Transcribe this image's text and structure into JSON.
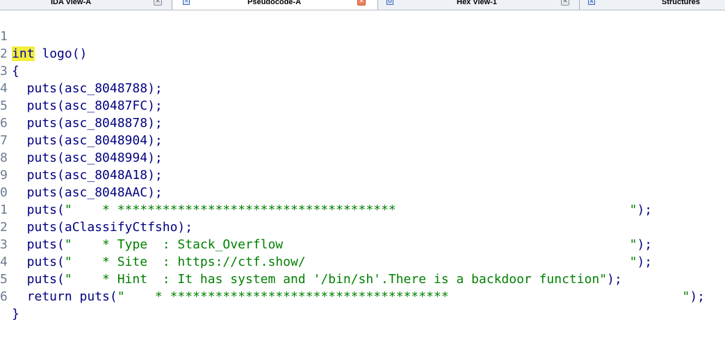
{
  "tabs": [
    {
      "label": "IDA View-A",
      "active": false,
      "icon": "ida-view-icon"
    },
    {
      "label": "Pseudocode-A",
      "active": true,
      "icon": "pseudocode-icon"
    },
    {
      "label": "Hex View-1",
      "active": false,
      "icon": "hex-view-icon"
    },
    {
      "label": "Structures",
      "active": false,
      "icon": "structures-icon"
    }
  ],
  "close_glyph": "✕",
  "code": {
    "line_numbers": [
      "1",
      "2",
      "3",
      "4",
      "5",
      "6",
      "7",
      "8",
      "9",
      "0",
      "1",
      "2",
      "3",
      "4",
      "5",
      "6"
    ],
    "lines": {
      "l1_kw": "int",
      "l1_rest": " logo()",
      "l2": "{",
      "l3": "  puts(asc_8048788);",
      "l4": "  puts(asc_80487FC);",
      "l5": "  puts(asc_8048878);",
      "l6": "  puts(asc_8048904);",
      "l7": "  puts(asc_8048994);",
      "l8": "  puts(asc_8048A18);",
      "l9": "  puts(asc_8048AAC);",
      "l10_pre": "  puts(",
      "l10_str": "\"    * *************************************                               \"",
      "l10_post": ");",
      "l11": "  puts(aClassifyCtfsho);",
      "l12_pre": "  puts(",
      "l12_str": "\"    * Type  : Stack_Overflow                                              \"",
      "l12_post": ");",
      "l13_pre": "  puts(",
      "l13_str": "\"    * Site  : https://ctf.show/                                           \"",
      "l13_post": ");",
      "l14_pre": "  puts(",
      "l14_str": "\"    * Hint  : It has system and '/bin/sh'.There is a backdoor function\"",
      "l14_post": ");",
      "l15_pre": "  return puts(",
      "l15_str": "\"    * *************************************                               \"",
      "l15_post": ");",
      "l16": "}"
    }
  },
  "colors": {
    "keyword_highlight": "#f4ee3a",
    "identifier": "#000080",
    "string": "#008000"
  }
}
